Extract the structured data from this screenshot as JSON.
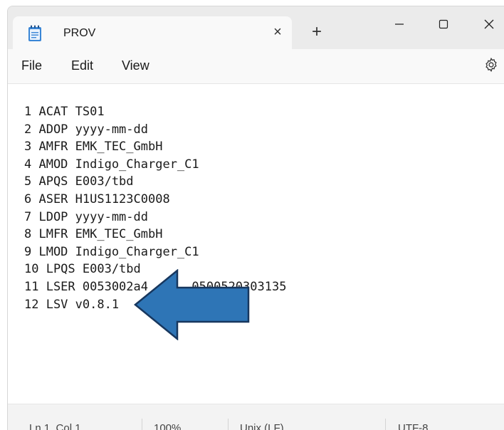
{
  "tab": {
    "title": "PROV",
    "close_symbol": "×",
    "new_tab_symbol": "+"
  },
  "window_controls": {
    "minimize": "—",
    "maximize": "☐",
    "close": "✕"
  },
  "menu": {
    "file": "File",
    "edit": "Edit",
    "view": "View"
  },
  "icons": {
    "tab": "notepad-icon",
    "settings": "gear-icon",
    "annotation": "arrow-left-icon"
  },
  "colors": {
    "arrow_fill": "#2e75b6",
    "arrow_stroke": "#17375e"
  },
  "editor": {
    "lines": [
      "1 ACAT TS01",
      "2 ADOP yyyy-mm-dd",
      "3 AMFR EMK_TEC_GmbH",
      "4 AMOD Indigo_Charger_C1",
      "5 APQS E003/tbd",
      "6 ASER H1US1123C0008",
      "7 LDOP yyyy-mm-dd",
      "8 LMFR EMK_TEC_GmbH",
      "9 LMOD Indigo_Charger_C1",
      "10 LPQS E003/tbd",
      "11 LSER 0053002a4      0500520303135",
      "12 LSV v0.8.1"
    ]
  },
  "status": {
    "position": "Ln 1, Col 1",
    "zoom": "100%",
    "line_ending": "Unix (LF)",
    "encoding": "UTF-8"
  }
}
